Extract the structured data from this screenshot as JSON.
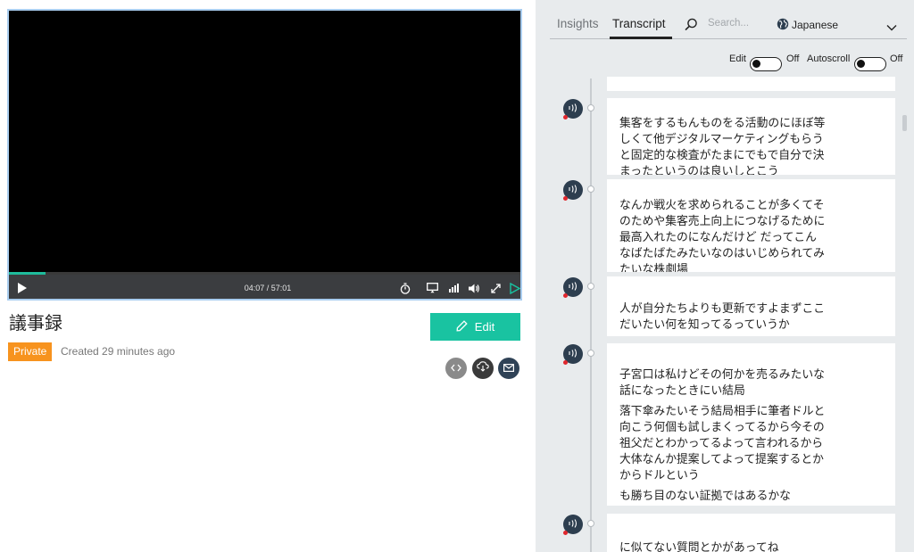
{
  "player": {
    "time_display": "04:07 / 57:01",
    "progress_fraction": 0.072
  },
  "media": {
    "title": "議事録",
    "edit_label": "Edit",
    "privacy_badge": "Private",
    "created_text": "Created 29 minutes ago"
  },
  "panel": {
    "tabs": [
      {
        "label": "Insights",
        "active": false
      },
      {
        "label": "Transcript",
        "active": true
      }
    ],
    "search_placeholder": "Search...",
    "language": "Japanese",
    "edit_toggle": {
      "label": "Edit",
      "state": "Off"
    },
    "autoscroll_toggle": {
      "label": "Autoscroll",
      "state": "Off"
    }
  },
  "transcript": {
    "blocks": [
      {
        "lines": [
          "集客をするもんものをる活動のにほぼ等しくて他デジタルマーケティングもらうと固定的な検査がたまにでもで自分で決まったというのは良いしとこう"
        ]
      },
      {
        "lines": [
          "なんか戦火を求められることが多くてそのためや集客売上向上につなげるために最高入れたのになんだけど だってこんなばたばたみたいなのはいじめられてみたいな株劇場"
        ]
      },
      {
        "lines": [
          "人が自分たちよりも更新ですよまずここだいたい何を知ってるっていうか"
        ]
      },
      {
        "lines": [
          "子宮口は私けどその何かを売るみたいな話になったときにい結局",
          "落下傘みたいそう結局相手に筆者ドルと向こう何個も試しまくってるから今その祖父だとわかってるよって言われるから大体なんか提案してよって提案するとかからドルという",
          "も勝ち目のない証拠ではあるかな"
        ]
      },
      {
        "lines": [
          "に似てない質問とかがあってね"
        ]
      }
    ]
  },
  "colors": {
    "accent_green": "#19c3a1",
    "private_orange": "#f7931e",
    "player_border": "#a9cdef",
    "speaker_navy": "#2d3e4f",
    "speaker_dot_red": "#e0262d"
  }
}
